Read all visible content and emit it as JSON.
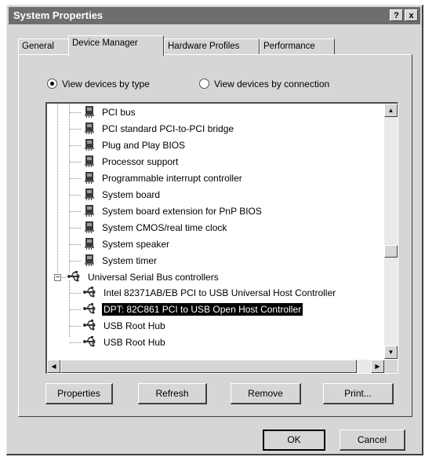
{
  "window": {
    "title": "System Properties",
    "help_label": "?",
    "close_label": "x"
  },
  "tabs": [
    "General",
    "Device Manager",
    "Hardware Profiles",
    "Performance"
  ],
  "active_tab": "Device Manager",
  "view_options": {
    "by_type": "View devices by type",
    "by_connection": "View devices by connection",
    "selected": "by_type"
  },
  "devices": {
    "system_children": [
      "PCI bus",
      "PCI standard PCI-to-PCI bridge",
      "Plug and Play BIOS",
      "Processor support",
      "Programmable interrupt controller",
      "System board",
      "System board extension for PnP BIOS",
      "System CMOS/real time clock",
      "System speaker",
      "System timer"
    ],
    "usb_category": "Universal Serial Bus controllers",
    "usb_children": [
      "Intel 82371AB/EB PCI to USB Universal Host Controller",
      "DPT: 82C861 PCI to USB Open Host Controller",
      "USB Root Hub",
      "USB Root Hub"
    ],
    "selected": "DPT: 82C861 PCI to USB Open Host Controller"
  },
  "action_buttons": {
    "properties": "Properties",
    "refresh": "Refresh",
    "remove": "Remove",
    "print": "Print..."
  },
  "dialog_buttons": {
    "ok": "OK",
    "cancel": "Cancel"
  }
}
